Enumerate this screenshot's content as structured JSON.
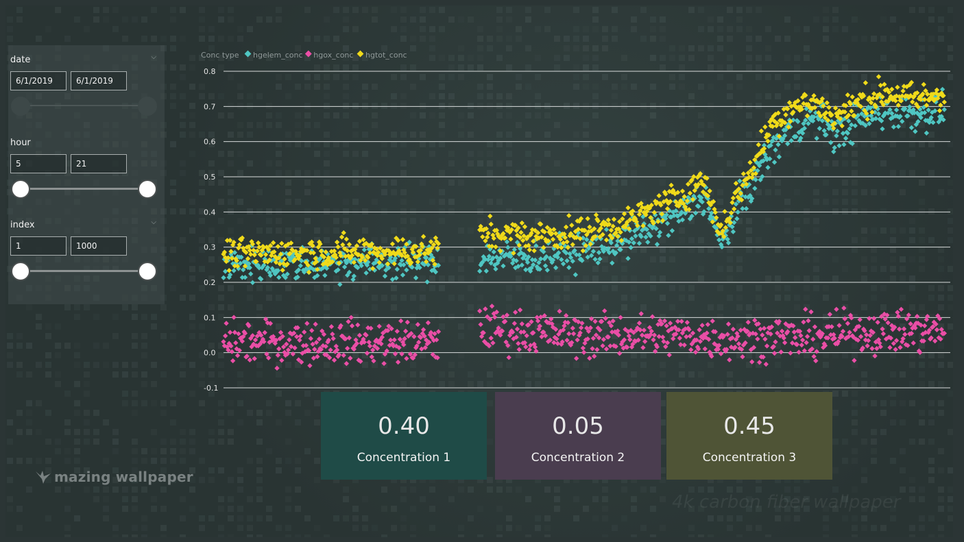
{
  "slicers": {
    "date": {
      "title": "date",
      "start": "6/1/2019",
      "end": "6/1/2019",
      "slider_low": 0,
      "slider_high": 1,
      "enabled": false
    },
    "hour": {
      "title": "hour",
      "start": "5",
      "end": "21",
      "slider_low": 0,
      "slider_high": 1,
      "enabled": true
    },
    "index": {
      "title": "index",
      "start": "1",
      "end": "1000",
      "slider_low": 0,
      "slider_high": 1,
      "enabled": true
    }
  },
  "legend": {
    "title": "Conc type",
    "items": [
      {
        "label": "hgelem_conc",
        "color": "#4fc6c2"
      },
      {
        "label": "hgox_conc",
        "color": "#ea4ea6"
      },
      {
        "label": "hgtot_conc",
        "color": "#f0da1a"
      }
    ]
  },
  "chart_data": {
    "type": "scatter",
    "title": "",
    "xlabel": "",
    "ylabel": "",
    "ylim": [
      -0.1,
      0.8
    ],
    "y_ticks": [
      "0.8",
      "0.7",
      "0.6",
      "0.5",
      "0.4",
      "0.3",
      "0.2",
      "0.1",
      "0.0",
      "-0.1"
    ],
    "x_range": [
      1,
      1000
    ],
    "grid": true,
    "legend_position": "top-left",
    "series": [
      {
        "name": "hgelem_conc",
        "color": "#4fc6c2",
        "trend": [
          [
            1,
            0.25
          ],
          [
            300,
            0.26
          ],
          [
            360,
            0.27
          ],
          [
            430,
            0.27
          ],
          [
            500,
            0.29
          ],
          [
            560,
            0.32
          ],
          [
            600,
            0.36
          ],
          [
            640,
            0.4
          ],
          [
            660,
            0.44
          ],
          [
            670,
            0.44
          ],
          [
            690,
            0.3
          ],
          [
            710,
            0.4
          ],
          [
            730,
            0.47
          ],
          [
            760,
            0.58
          ],
          [
            790,
            0.64
          ],
          [
            820,
            0.67
          ],
          [
            850,
            0.62
          ],
          [
            880,
            0.66
          ],
          [
            920,
            0.69
          ],
          [
            960,
            0.68
          ],
          [
            1000,
            0.69
          ]
        ]
      },
      {
        "name": "hgox_conc",
        "color": "#ea4ea6",
        "trend": [
          [
            1,
            0.03
          ],
          [
            300,
            0.03
          ],
          [
            360,
            0.07
          ],
          [
            430,
            0.06
          ],
          [
            500,
            0.05
          ],
          [
            560,
            0.05
          ],
          [
            600,
            0.05
          ],
          [
            640,
            0.05
          ],
          [
            690,
            0.04
          ],
          [
            730,
            0.04
          ],
          [
            760,
            0.05
          ],
          [
            800,
            0.04
          ],
          [
            850,
            0.05
          ],
          [
            880,
            0.06
          ],
          [
            920,
            0.06
          ],
          [
            960,
            0.06
          ],
          [
            1000,
            0.06
          ]
        ]
      },
      {
        "name": "hgtot_conc",
        "color": "#f0da1a",
        "trend": [
          [
            1,
            0.28
          ],
          [
            300,
            0.29
          ],
          [
            360,
            0.34
          ],
          [
            430,
            0.33
          ],
          [
            500,
            0.34
          ],
          [
            560,
            0.37
          ],
          [
            600,
            0.41
          ],
          [
            640,
            0.45
          ],
          [
            660,
            0.49
          ],
          [
            670,
            0.47
          ],
          [
            690,
            0.34
          ],
          [
            710,
            0.44
          ],
          [
            730,
            0.51
          ],
          [
            760,
            0.65
          ],
          [
            790,
            0.7
          ],
          [
            820,
            0.71
          ],
          [
            850,
            0.67
          ],
          [
            880,
            0.71
          ],
          [
            920,
            0.74
          ],
          [
            960,
            0.72
          ],
          [
            1000,
            0.74
          ]
        ]
      }
    ],
    "x_gap": [
      300,
      355
    ]
  },
  "cards": [
    {
      "value": "0.40",
      "label": "Concentration 1",
      "color": "#1f4b47"
    },
    {
      "value": "0.05",
      "label": "Concentration 2",
      "color": "#4a3d4f"
    },
    {
      "value": "0.45",
      "label": "Concentration 3",
      "color": "#4f5436"
    }
  ],
  "watermark": "mazing wallpaper",
  "wallpaper_caption": "4k carbon fiber wallpaper"
}
